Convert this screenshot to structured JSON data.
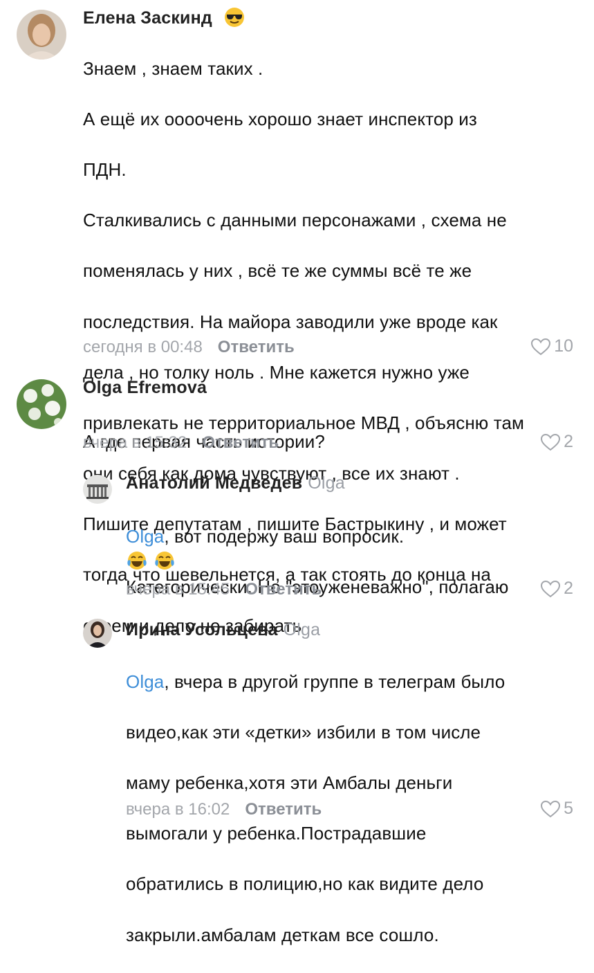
{
  "comments": [
    {
      "author": "Елена Заскинд",
      "lines": [
        "Знаем , знаем таких .",
        "А ещё их оооочень хорошо знает инспектор из",
        "ПДН.",
        "Сталкивались с данными персонажами , схема не",
        "поменялась у них , всё те же суммы всё те же",
        "последствия. На майора заводили уже вроде как",
        "дела , но толку ноль . Мне кажется нужно уже",
        "привлекать не территориальное МВД , объясню там",
        "они себя как дома чувствуют , все их знают .",
        "Пишите депутатам , пишите Бастрыкину , и может",
        "тогда что шевельнется, а так стоять до конца на",
        "своем и дело не забирать"
      ],
      "time": "сегодня в 00:48",
      "reply_label": "Ответить",
      "likes": "10"
    },
    {
      "author": "Olga Efremova",
      "lines": [
        "А где первая часть истории?"
      ],
      "time": "вчера в 15:32",
      "reply_label": "Ответить",
      "likes": "2"
    },
    {
      "author": "Анатолий Медведев",
      "reply_to": "Olga",
      "mention": "Olga",
      "first_line_rest": ", вот подержу ваш вопросик.",
      "lines": [
        "Категорически. Но \"этоуженеважно\", полагаю"
      ],
      "time": "вчера в 15:45",
      "reply_label": "Ответить",
      "likes": "2"
    },
    {
      "author": "Ирина Усольцева",
      "reply_to": "Olga",
      "mention": "Olga",
      "first_line_rest": ", вчера в другой группе в телеграм было",
      "lines": [
        "видео,как эти «детки» избили в том числе",
        "маму ребенка,хотя эти Амбалы деньги",
        "вымогали у ребенка.Пострадавшие",
        "обратились в полицию,но как видите дело",
        "закрыли.амбалам деткам все сошло."
      ],
      "time": "вчера в 16:02",
      "reply_label": "Ответить",
      "likes": "5"
    }
  ],
  "icons": {
    "author_emoji": "smiling-face-with-sunglasses",
    "laugh_emoji": "face-with-tears-of-joy",
    "like": "heart-outline"
  },
  "colors": {
    "mention": "#3e8ed8",
    "meta": "#a3a6ab",
    "reply_button": "#8b8f96"
  }
}
